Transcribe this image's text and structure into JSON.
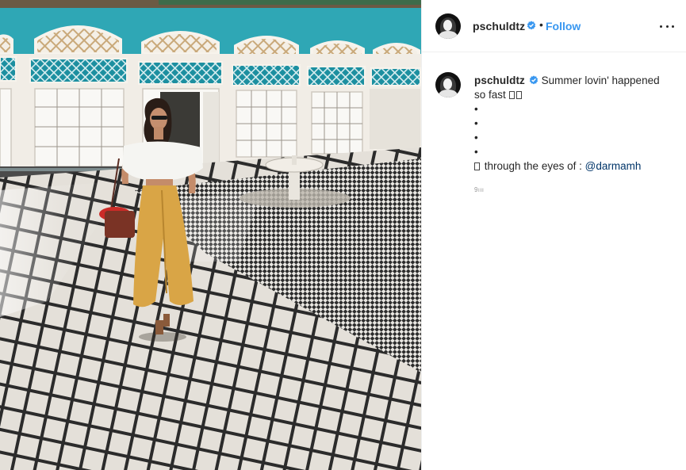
{
  "post": {
    "username": "pschuldtz",
    "follow_label": "Follow",
    "separator": "•",
    "caption": {
      "username": "pschuldtz",
      "text_line1": "Summer lovin' happened",
      "text_line2": "so fast",
      "bullets": [
        "•",
        "•",
        "•",
        "•"
      ],
      "credit_prefix": "through the eyes of :",
      "mention": "@darmamh"
    },
    "timestamp": "9ııı"
  },
  "colors": {
    "link": "#3897f0",
    "mention": "#003569",
    "verified": "#3897f0"
  },
  "icons": [
    "verified-badge-icon",
    "more-options-icon"
  ]
}
